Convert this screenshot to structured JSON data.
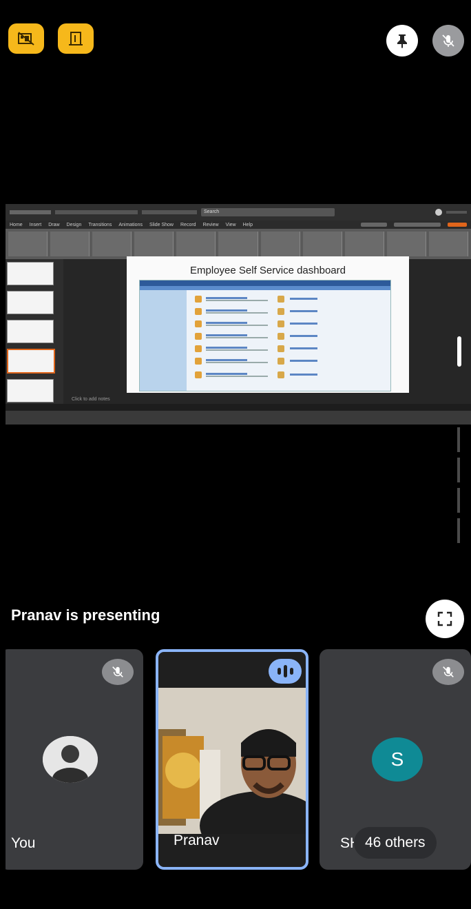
{
  "top_controls": {
    "left_buttons": [
      "no-camera-icon",
      "door-exit-icon"
    ],
    "right_buttons": [
      "pin-icon",
      "mic-off-icon"
    ]
  },
  "presentation": {
    "app_search": "Search",
    "menu": [
      "Home",
      "Insert",
      "Draw",
      "Design",
      "Transitions",
      "Animations",
      "Slide Show",
      "Record",
      "Review",
      "View",
      "Help"
    ],
    "slide_title": "Employee Self Service dashboard",
    "notes_placeholder": "Click to add notes"
  },
  "presenting_text": "Pranav is presenting",
  "participants": {
    "you": {
      "name": "You"
    },
    "pranav": {
      "name": "Pranav"
    },
    "third": {
      "name": "SH",
      "initial": "S"
    },
    "others": "46 others"
  },
  "colors": {
    "accent_yellow": "#f6b81b",
    "speaking_blue": "#8ab4f8",
    "avatar_teal": "#0f8a95",
    "tile_bg": "#3b3c3f"
  }
}
